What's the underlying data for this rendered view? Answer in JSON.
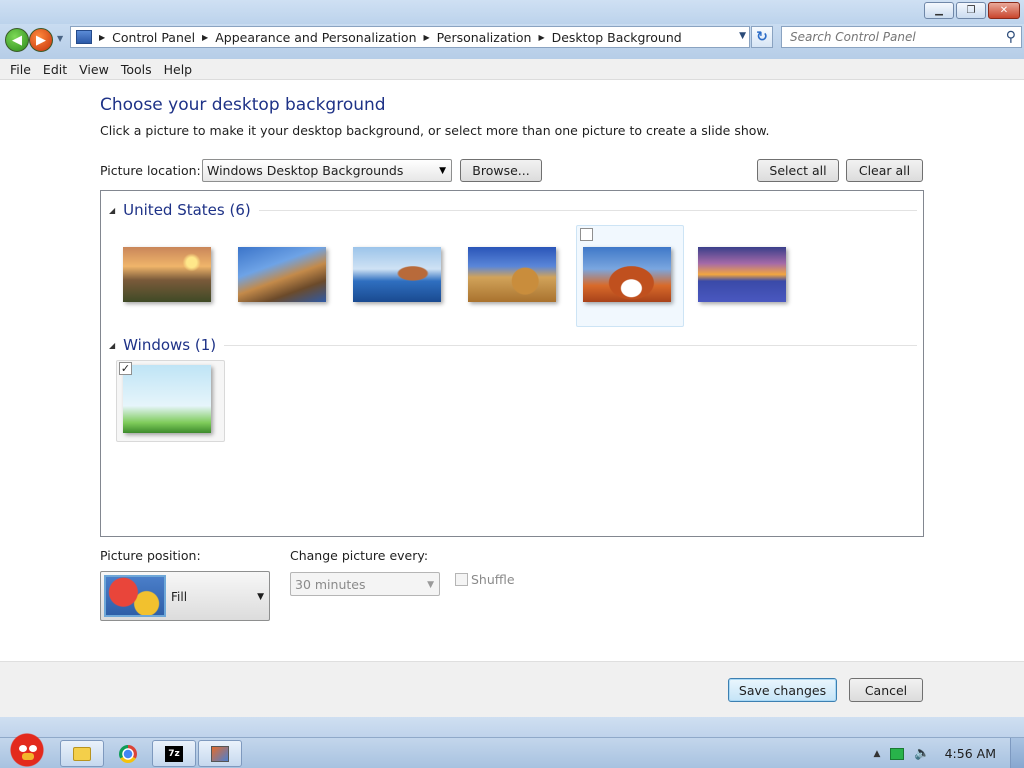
{
  "window": {
    "buttons": {
      "minimize": "▁",
      "restore": "❐",
      "close": "✕"
    }
  },
  "nav": {
    "breadcrumbs": [
      "Control Panel",
      "Appearance and Personalization",
      "Personalization",
      "Desktop Background"
    ],
    "search_placeholder": "Search Control Panel"
  },
  "menu": [
    "File",
    "Edit",
    "View",
    "Tools",
    "Help"
  ],
  "page": {
    "title": "Choose your desktop background",
    "description": "Click a picture to make it your desktop background, or select more than one picture to create a slide show.",
    "location_label": "Picture location:",
    "location_value": "Windows Desktop Backgrounds",
    "browse_label": "Browse...",
    "select_all_label": "Select all",
    "clear_all_label": "Clear all"
  },
  "gallery": {
    "groups": [
      {
        "title": "United States (6)",
        "thumbnails": [
          {
            "subject": "sunset-valley",
            "checked": false
          },
          {
            "subject": "lighthouse",
            "checked": false
          },
          {
            "subject": "rock-coast",
            "checked": false
          },
          {
            "subject": "hay-bale",
            "checked": false
          },
          {
            "subject": "arch",
            "checked": false,
            "hovered": true
          },
          {
            "subject": "lake-flowers",
            "checked": false
          }
        ]
      },
      {
        "title": "Windows (1)",
        "thumbnails": [
          {
            "subject": "windows-rays",
            "checked": true
          }
        ]
      }
    ]
  },
  "options": {
    "position_label": "Picture position:",
    "position_value": "Fill",
    "change_label": "Change picture every:",
    "interval_value": "30 minutes",
    "shuffle_label": "Shuffle",
    "shuffle_checked": false
  },
  "footer": {
    "save_label": "Save changes",
    "cancel_label": "Cancel"
  },
  "taskbar": {
    "clock": "4:56 AM"
  }
}
